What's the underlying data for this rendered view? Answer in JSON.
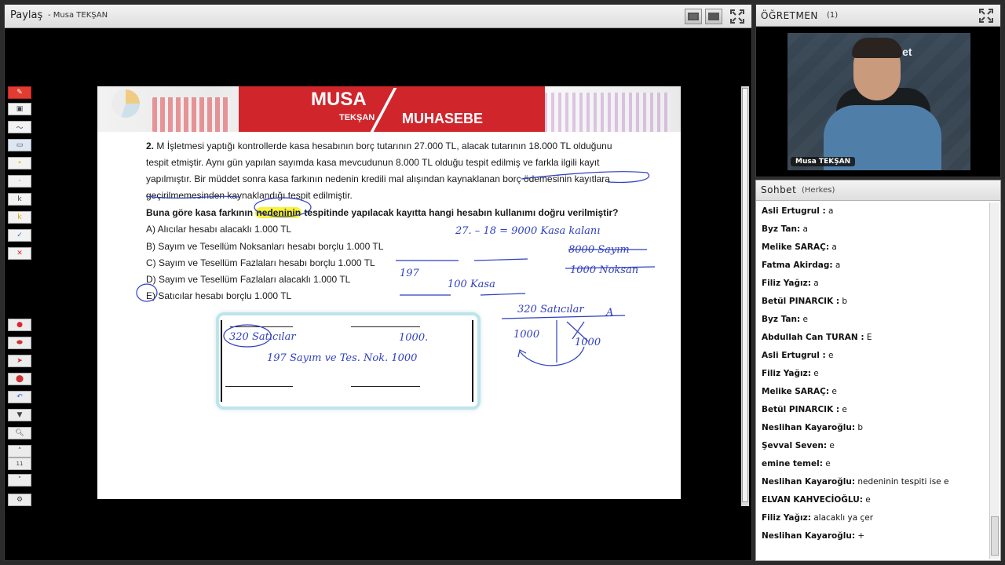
{
  "share": {
    "title": "Paylaş",
    "subtitle": "- Musa TEKŞAN"
  },
  "document": {
    "banner": {
      "brand_top": "MUSA",
      "brand_sub": "TEKŞAN",
      "brand_right": "MUHASEBE"
    },
    "question": {
      "number": "2.",
      "lines": [
        "M İşletmesi yaptığı kontrollerde kasa hesabının borç tutarının 27.000 TL, alacak tutarının 18.000 TL olduğunu",
        "tespit etmiştir. Aynı gün yapılan sayımda kasa mevcudunun 8.000 TL olduğu tespit edilmiş ve farkla ilgili kayıt",
        "yapılmıştır. Bir müddet sonra kasa farkının nedenin kredili mal alışından kaynaklanan borç ödemesinin kayıtlara",
        "geçirilmemesinden kaynaklandığı tespit edilmiştir."
      ],
      "prompt_before": "Buna göre kasa farkının ",
      "prompt_highlight": "nedeninin",
      "prompt_after": " tespitinde yapılacak kayıtta hangi hesabın kullanımı doğru verilmiştir?",
      "options": [
        "A) Alıcılar hesabı alacaklı 1.000 TL",
        "B) Sayım ve Tesellüm Noksanları hesabı borçlu 1.000 TL",
        "C) Sayım ve Tesellüm Fazlaları hesabı borçlu 1.000 TL",
        "D) Sayım ve Tesellüm Fazlaları alacaklı 1.000 TL",
        "E) Satıcılar hesabı borçlu 1.000 TL"
      ]
    },
    "handwriting": {
      "calc1": "27. – 18 = 9000 Kasa kalanı",
      "calc2": "8000 Sayım",
      "calc3": "1000 Noksan",
      "journal1": "197",
      "journal2": "100 Kasa",
      "taccount_title": "320 Satıcılar",
      "taccount_side": "A",
      "taccount_left": "1000",
      "taccount_right": "1000",
      "box_line1": "320 Satıcılar",
      "box_amount": "1000.",
      "box_line2": "197 Sayım ve Tes. Nok. 1000"
    }
  },
  "teacher": {
    "title": "ÖĞRETMEN",
    "count": "(1)",
    "video_brand": "si.net",
    "name": "Musa TEKŞAN"
  },
  "chat": {
    "title": "Sohbet",
    "scope": "(Herkes)",
    "messages": [
      {
        "name": "Asli Ertugrul :",
        "text": " a"
      },
      {
        "name": "Byz Tan:",
        "text": " a"
      },
      {
        "name": "Melike SARAÇ:",
        "text": " a"
      },
      {
        "name": "Fatma Akirdag:",
        "text": " a"
      },
      {
        "name": "Filiz Yağız:",
        "text": " a"
      },
      {
        "name": "Betül PINARCIK :",
        "text": " b"
      },
      {
        "name": "Byz Tan:",
        "text": " e"
      },
      {
        "name": "Abdullah Can  TURAN :",
        "text": " E"
      },
      {
        "name": "Asli Ertugrul :",
        "text": " e"
      },
      {
        "name": "Filiz Yağız:",
        "text": " e"
      },
      {
        "name": "Melike SARAÇ:",
        "text": " e"
      },
      {
        "name": "Betül PINARCIK :",
        "text": " e"
      },
      {
        "name": "Neslihan Kayaroğlu:",
        "text": " b"
      },
      {
        "name": "Şevval Seven:",
        "text": " e"
      },
      {
        "name": "emine temel:",
        "text": " e"
      },
      {
        "name": "Neslihan Kayaroğlu:",
        "text": " nedeninin tespiti ise e"
      },
      {
        "name": "ELVAN KAHVECİOĞLU:",
        "text": " e"
      },
      {
        "name": "Filiz Yağız:",
        "text": " alacaklı ya çer"
      },
      {
        "name": "Neslihan Kayaroğlu:",
        "text": " +"
      }
    ]
  },
  "colors": {
    "ink": "#2f3fc0",
    "accent_red": "#d1252c",
    "highlight": "#f7f23a"
  }
}
